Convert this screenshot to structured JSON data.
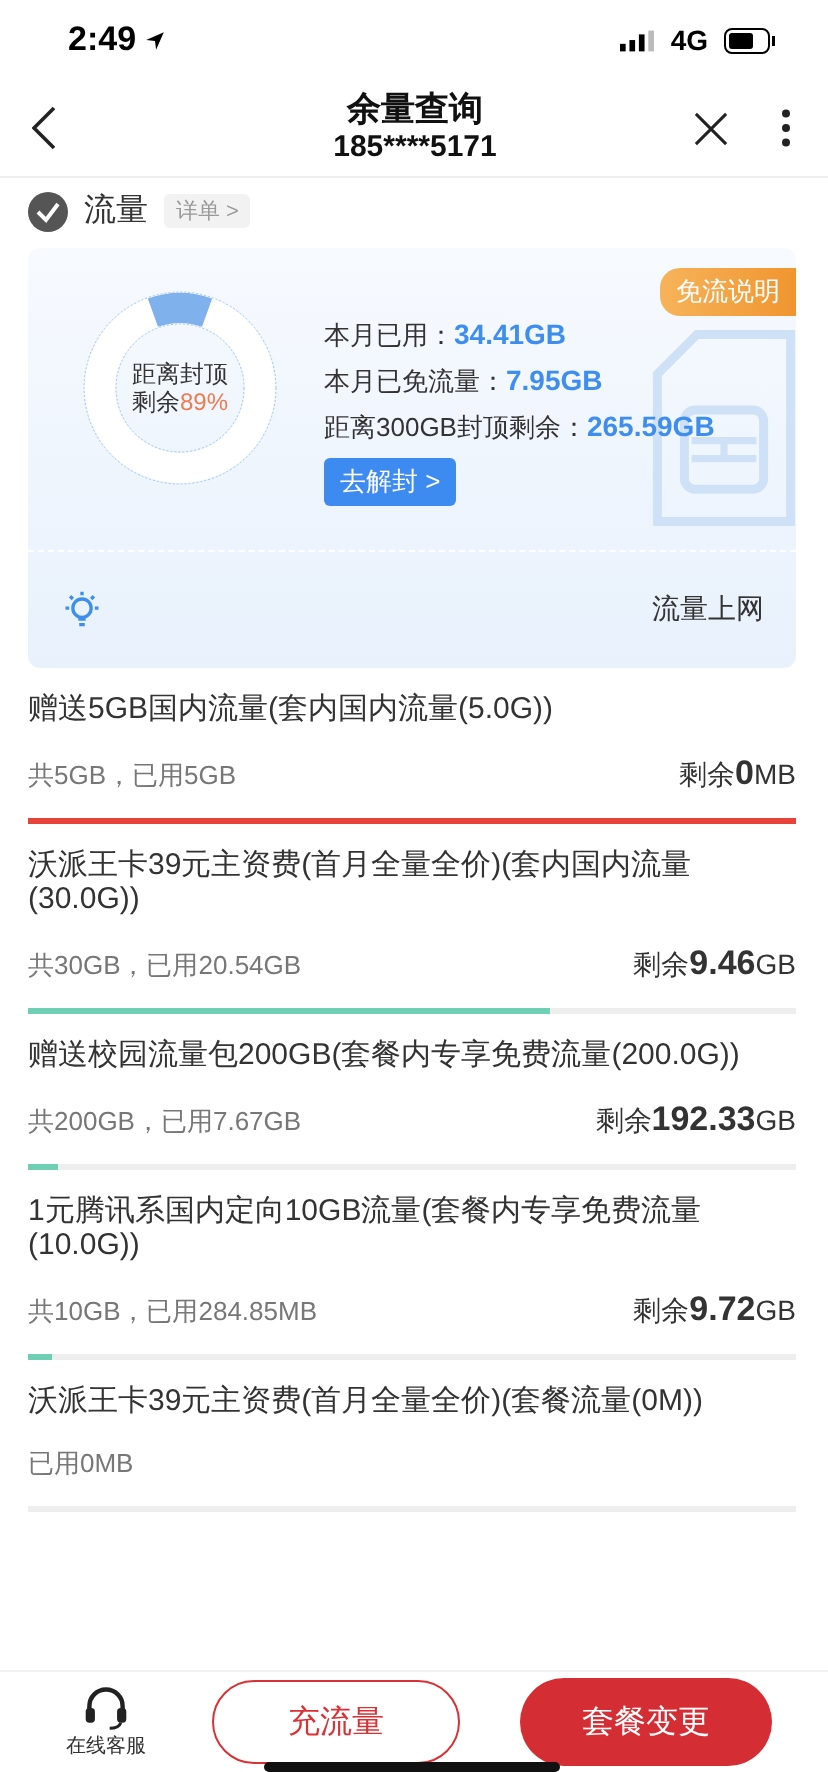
{
  "status_bar": {
    "time": "2:49",
    "network": "4G"
  },
  "header": {
    "title": "余量查询",
    "subtitle": "185****5171"
  },
  "section": {
    "title": "流量",
    "link": "详单 >"
  },
  "summary": {
    "ring_label": "距离封顶",
    "ring_remain_label": "剩余",
    "ring_percent": "89%",
    "badge": "免流说明",
    "stats": [
      {
        "label": "本月已用：",
        "value": "34.41GB"
      },
      {
        "label": "本月已免流量：",
        "value": "7.95GB"
      },
      {
        "label": "距离300GB封顶剩余：",
        "value": "265.59GB"
      }
    ],
    "unlock_button": "去解封 >",
    "tip": "流量上网"
  },
  "packages": [
    {
      "kind": "quota",
      "name": "赠送5GB国内流量(套内国内流量(5.0G))",
      "usage": "共5GB，已用5GB",
      "remain_label": "剩余",
      "remain_value": "0",
      "remain_unit": "MB",
      "level": 1,
      "color": "#e8433a"
    },
    {
      "kind": "quota",
      "name": "沃派王卡39元主资费(首月全量全价)(套内国内流量(30.0G))",
      "usage": "共30GB，已用20.54GB",
      "remain_label": "剩余",
      "remain_value": "9.46",
      "remain_unit": "GB",
      "level": 0.68,
      "color": "#6fcfb4"
    },
    {
      "kind": "quota",
      "name": "赠送校园流量包200GB(套餐内专享免费流量(200.0G))",
      "usage": "共200GB，已用7.67GB",
      "remain_label": "剩余",
      "remain_value": "192.33",
      "remain_unit": "GB",
      "level": 0.04,
      "color": "#6fcfb4"
    },
    {
      "kind": "quota",
      "name": "1元腾讯系国内定向10GB流量(套餐内专享免费流量(10.0G))",
      "usage": "共10GB，已用284.85MB",
      "remain_label": "剩余",
      "remain_value": "9.72",
      "remain_unit": "GB",
      "level": 0.03,
      "color": "#6fcfb4"
    },
    {
      "kind": "used_only",
      "name": "沃派王卡39元主资费(首月全量全价)(套餐流量(0M))",
      "usage": "已用0MB"
    }
  ],
  "bottom_bar": {
    "service": "在线客服",
    "recharge": "充流量",
    "change": "套餐变更"
  }
}
